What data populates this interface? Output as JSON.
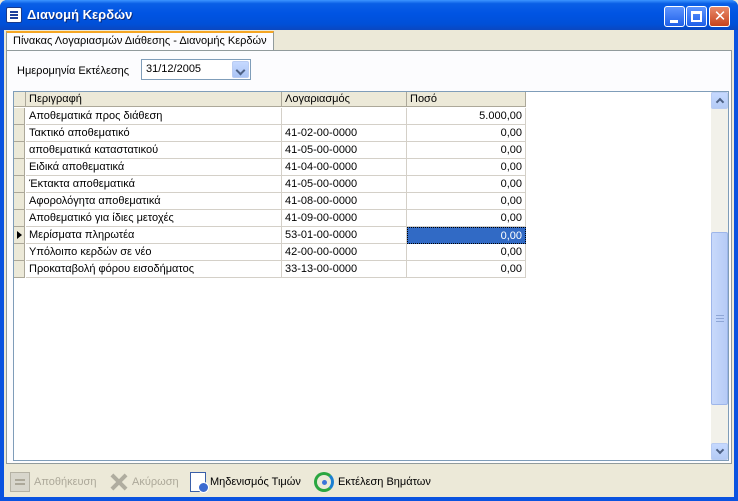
{
  "window": {
    "title": "Διανομή Κερδών"
  },
  "tab": {
    "label": "Πίνακας Λογαριασμών Διάθεσης - Διανομής Κερδών"
  },
  "form": {
    "date_label": "Ημερομηνία Εκτέλεσης",
    "date_value": "31/12/2005"
  },
  "grid": {
    "columns": [
      "Περιγραφή",
      "Λογαριασμός",
      "Ποσό"
    ],
    "rows": [
      {
        "desc": "Αποθεματικά προς διάθεση",
        "account": "",
        "amount": "5.000,00"
      },
      {
        "desc": "Τακτικό αποθεματικό",
        "account": "41-02-00-0000",
        "amount": "0,00"
      },
      {
        "desc": "αποθεματικά καταστατικού",
        "account": "41-05-00-0000",
        "amount": "0,00"
      },
      {
        "desc": "Ειδικά αποθεματικά",
        "account": "41-04-00-0000",
        "amount": "0,00"
      },
      {
        "desc": "Έκτακτα αποθεματικά",
        "account": "41-05-00-0000",
        "amount": "0,00"
      },
      {
        "desc": "Αφορολόγητα αποθεματικά",
        "account": "41-08-00-0000",
        "amount": "0,00"
      },
      {
        "desc": "Αποθεματικό για ίδιες μετοχές",
        "account": "41-09-00-0000",
        "amount": "0,00"
      },
      {
        "desc": "Μερίσματα πληρωτέα",
        "account": "53-01-00-0000",
        "amount": "0,00"
      },
      {
        "desc": "Υπόλοιπο κερδών σε νέο",
        "account": "42-00-00-0000",
        "amount": "0,00"
      },
      {
        "desc": "Προκαταβολή φόρου εισοδήματος",
        "account": "33-13-00-0000",
        "amount": "0,00"
      }
    ],
    "selected_row": 7
  },
  "toolbar": {
    "save_label": "Αποθήκευση",
    "cancel_label": "Ακύρωση",
    "reset_label": "Μηδενισμός Τιμών",
    "run_label": "Εκτέλεση Βημάτων"
  }
}
